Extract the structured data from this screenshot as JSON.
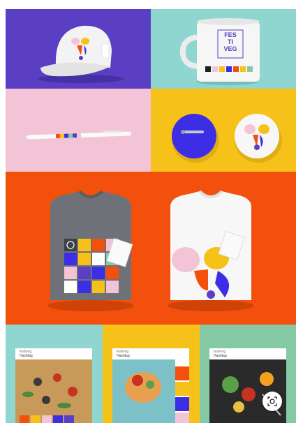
{
  "colors": {
    "purple": "#5a3fc4",
    "teal": "#8fd6d1",
    "pink": "#f2c4d6",
    "yellow": "#f6c21a",
    "orange": "#f2500c",
    "green": "#86c9a5",
    "blue": "#3d2ee6"
  },
  "mug": {
    "logo_lines": [
      "FES",
      "TI",
      "VEG"
    ]
  },
  "posts": [
    {
      "brand": "festiveg",
      "caption": "Hashtag"
    },
    {
      "brand": "festiveg",
      "caption": "Hashtag"
    },
    {
      "brand": "festiveg",
      "caption": "Hashtag"
    }
  ],
  "icons": {
    "lens_button": "lens-search-icon"
  }
}
